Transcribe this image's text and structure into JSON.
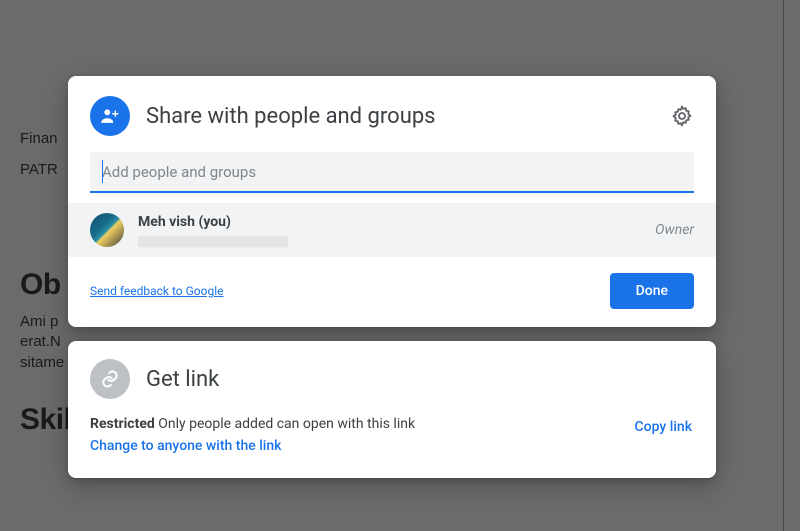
{
  "bgdoc": {
    "line1": "Finan",
    "line2": "PATR",
    "heading1": "Ob",
    "paragraph": "Ami p\nerat.N\nsitame",
    "heading2": "Skills"
  },
  "share": {
    "title": "Share with people and groups",
    "input_placeholder": "Add people and groups",
    "input_value": "",
    "person": {
      "name": "Meh vish (you)",
      "role": "Owner"
    },
    "feedback": "Send feedback to Google",
    "done": "Done"
  },
  "link": {
    "title": "Get link",
    "restriction_label": "Restricted",
    "restriction_text": " Only people added can open with this link",
    "change": "Change to anyone with the link",
    "copy": "Copy link"
  }
}
